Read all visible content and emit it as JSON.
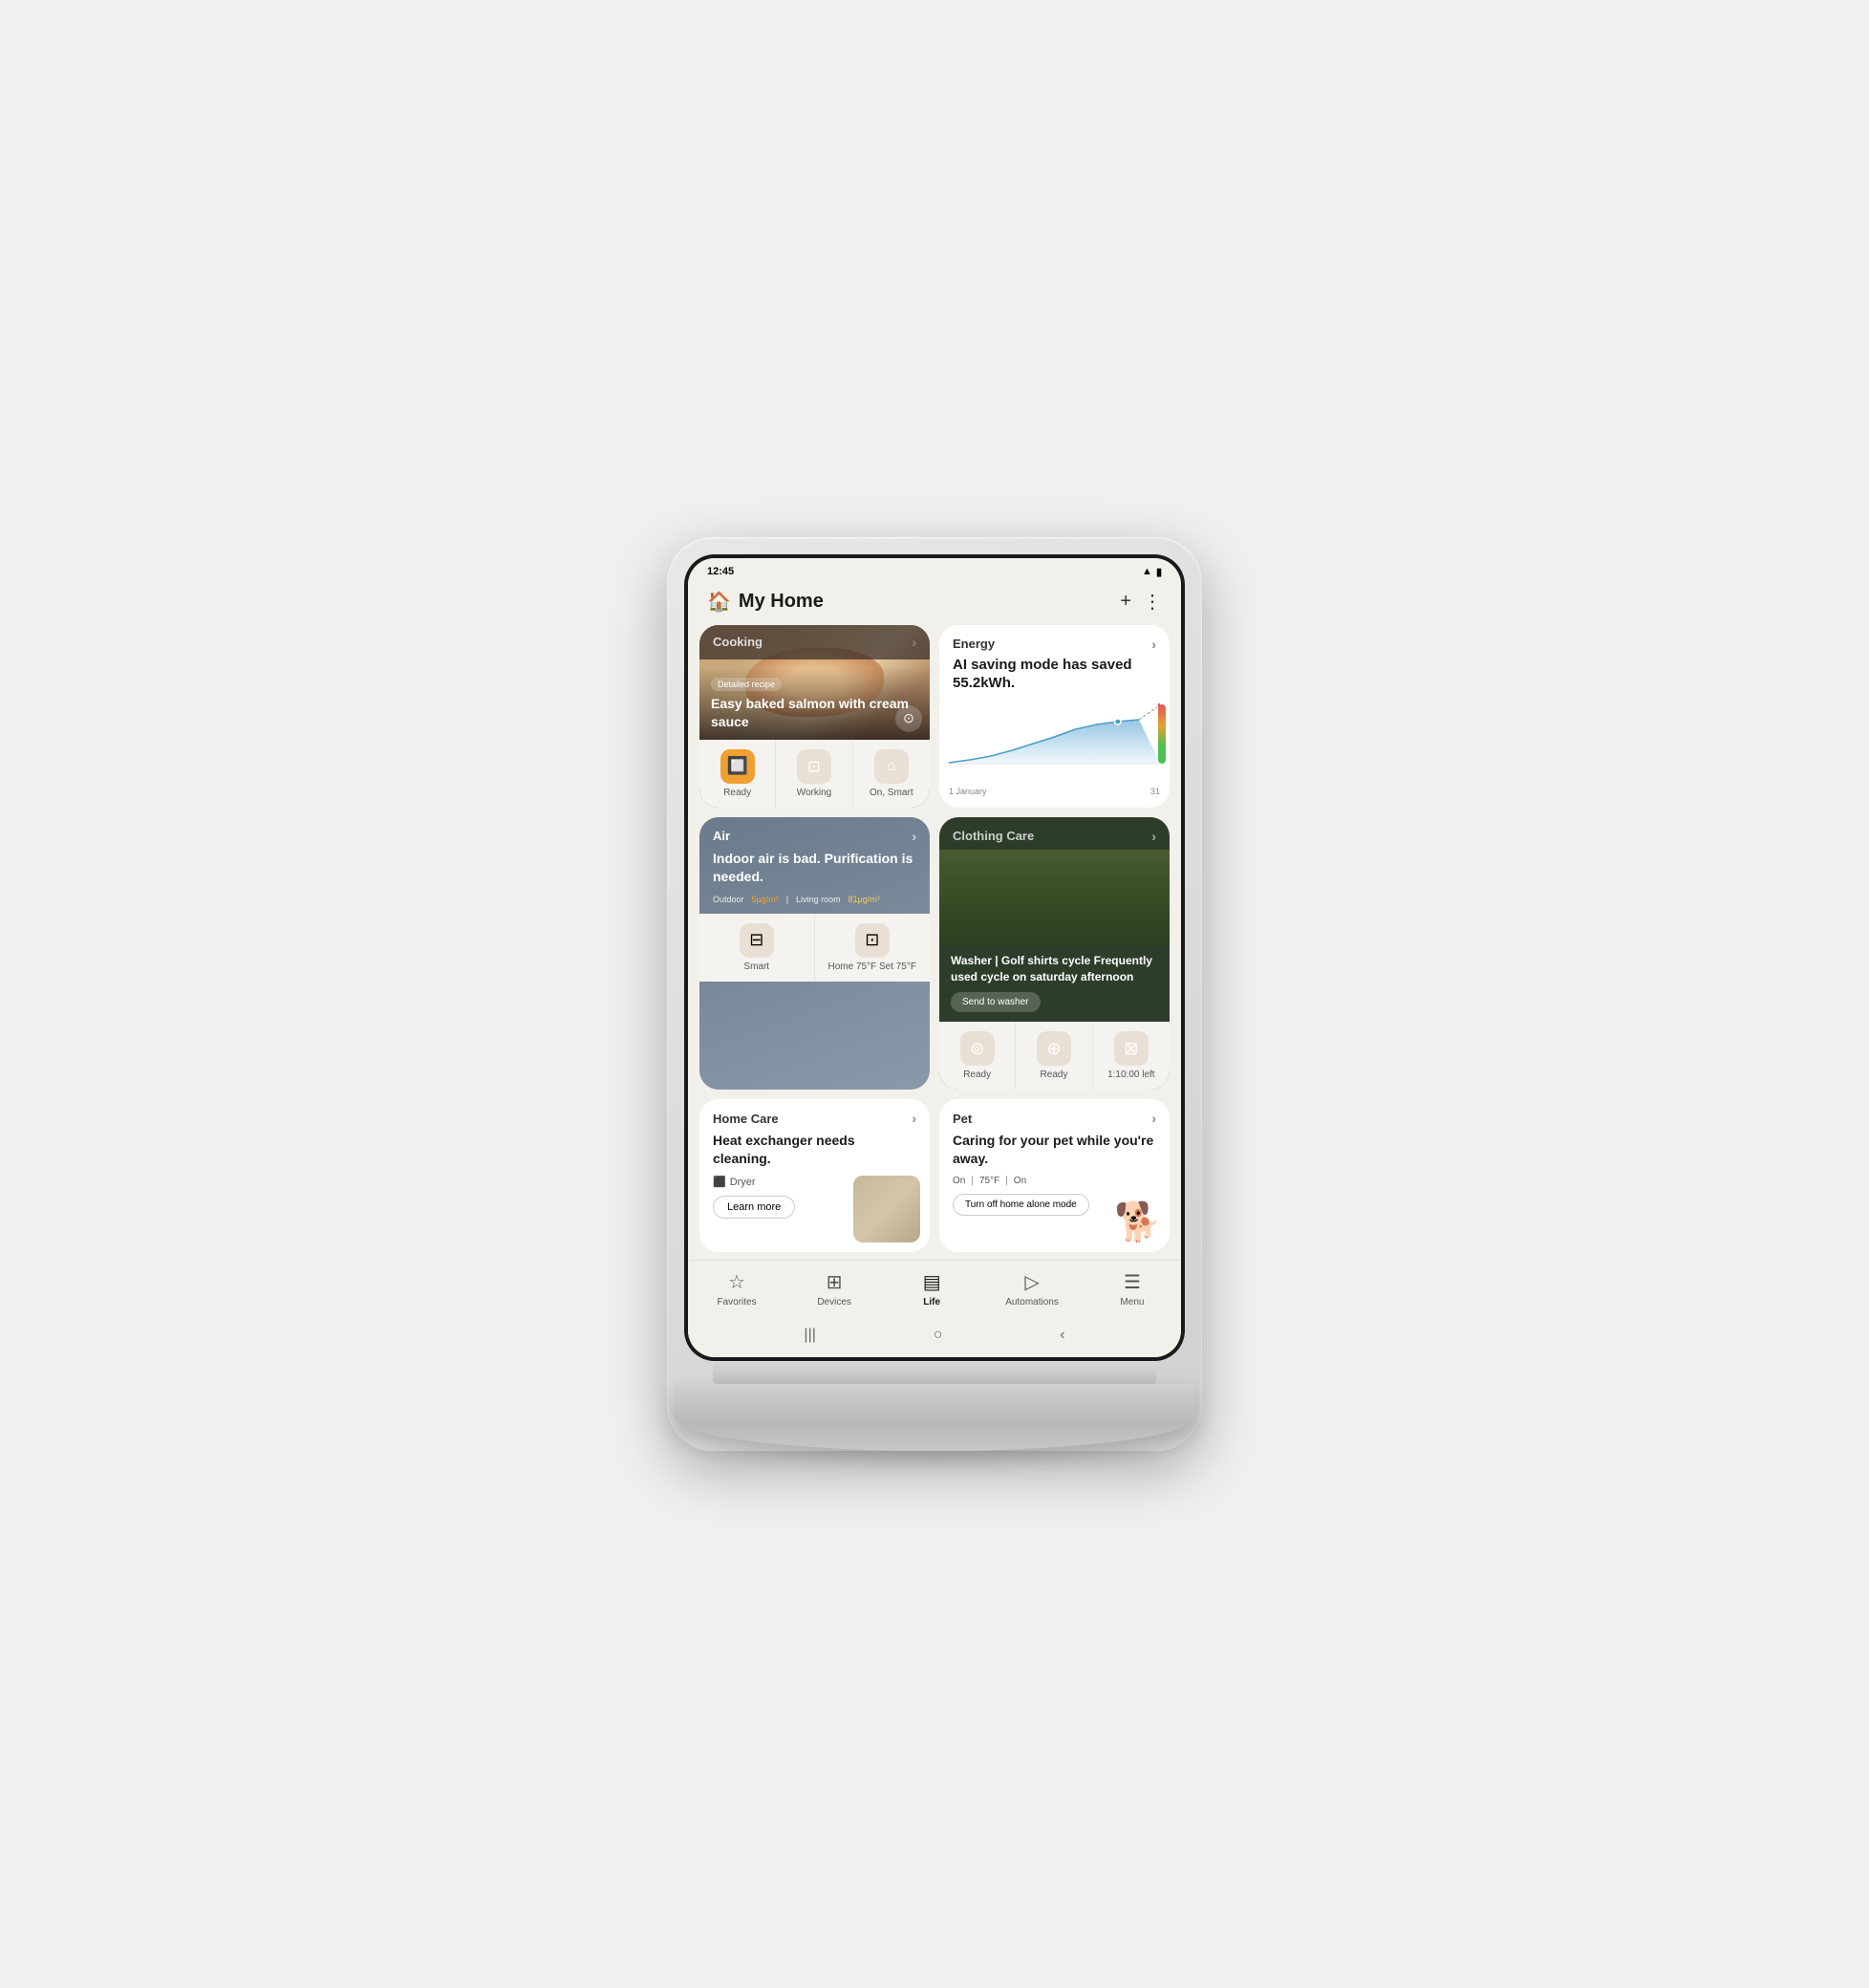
{
  "statusBar": {
    "time": "12:45",
    "signal": "▲",
    "battery": "🔋"
  },
  "header": {
    "title": "My Home",
    "addIcon": "+",
    "menuIcon": "⋮"
  },
  "cooking": {
    "sectionLabel": "Cooking",
    "title": "Easy baked salmon with cream sauce",
    "badge": "Detailed recipe",
    "devices": [
      {
        "label": "Ready",
        "iconBg": "orange"
      },
      {
        "label": "Working",
        "iconBg": "default"
      },
      {
        "label": "On, Smart",
        "iconBg": "default"
      }
    ]
  },
  "energy": {
    "sectionLabel": "Energy",
    "text": "AI saving mode has saved 55.2kWh.",
    "chartStart": "1 January",
    "chartEnd": "31"
  },
  "air": {
    "sectionLabel": "Air",
    "text": "Indoor air is bad. Purification is needed.",
    "outdoor": "Outdoor",
    "outdoorValue": "5μg/m³",
    "livingRoom": "Living room",
    "livingRoomValue": "81μg/m³",
    "devices": [
      {
        "label": "Smart"
      },
      {
        "label": "Home 75°F Set 75°F"
      }
    ]
  },
  "clothingCare": {
    "sectionLabel": "Clothing Care",
    "title": "Washer | Golf shirts cycle Frequently used cycle on saturday afternoon",
    "buttonLabel": "Send to washer",
    "devices": [
      {
        "label": "Ready"
      },
      {
        "label": "Ready"
      },
      {
        "label": "1:10:00 left"
      }
    ]
  },
  "homeCare": {
    "sectionLabel": "Home Care",
    "text": "Heat exchanger needs cleaning.",
    "applianceLabel": "Dryer",
    "buttonLabel": "Learn more"
  },
  "pet": {
    "sectionLabel": "Pet",
    "text": "Caring for your pet while you're away.",
    "metrics": [
      "On",
      "75°F",
      "On"
    ],
    "buttonLabel": "Turn off home alone mode"
  },
  "bottomNav": {
    "items": [
      {
        "label": "Favorites",
        "icon": "☆",
        "active": false
      },
      {
        "label": "Devices",
        "icon": "⊞",
        "active": false
      },
      {
        "label": "Life",
        "icon": "≡",
        "active": true
      },
      {
        "label": "Automations",
        "icon": "▷",
        "active": false
      },
      {
        "label": "Menu",
        "icon": "☰",
        "active": false
      }
    ]
  },
  "androidNav": {
    "back": "‹",
    "home": "○",
    "recents": "|||"
  }
}
